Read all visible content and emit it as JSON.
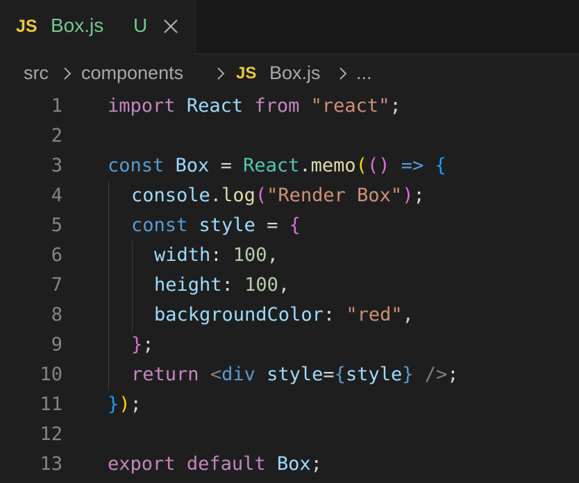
{
  "tab": {
    "icon_label": "JS",
    "file_name": "Box.js",
    "git_status": "U",
    "close_icon": "close-icon"
  },
  "breadcrumb": {
    "items": [
      "src",
      "components",
      "Box.js",
      "..."
    ],
    "file_icon_label": "JS",
    "separator_icon": "chevron-right-icon"
  },
  "editor": {
    "line_numbers": [
      "1",
      "2",
      "3",
      "4",
      "5",
      "6",
      "7",
      "8",
      "9",
      "10",
      "11",
      "12",
      "13"
    ],
    "tokens": {
      "l1": [
        "import",
        " ",
        "React",
        " ",
        "from",
        " ",
        "\"react\"",
        ";"
      ],
      "l3": [
        "const",
        " ",
        "Box",
        " = ",
        "React",
        ".",
        "memo",
        "(",
        "()",
        " => ",
        "{"
      ],
      "l4": [
        "console",
        ".",
        "log",
        "(",
        "\"Render Box\"",
        ")",
        ";"
      ],
      "l5": [
        "const",
        " ",
        "style",
        " = ",
        "{"
      ],
      "l6": [
        "width",
        ": ",
        "100",
        ","
      ],
      "l7": [
        "height",
        ": ",
        "100",
        ","
      ],
      "l8": [
        "backgroundColor",
        ": ",
        "\"red\"",
        ","
      ],
      "l9": [
        "}",
        ";"
      ],
      "l10": [
        "return",
        " ",
        "<",
        "div",
        " ",
        "style",
        "=",
        "{",
        "style",
        "}",
        " />",
        ";"
      ],
      "l11": [
        "}",
        ")",
        ";"
      ],
      "l13": [
        "export",
        " ",
        "default",
        " ",
        "Box",
        ";"
      ]
    }
  },
  "colors": {
    "background": "#1e1e1e",
    "tabbar": "#181818",
    "js_icon": "#e9c83c",
    "untracked": "#73c991",
    "keyword_control": "#c586c0",
    "keyword": "#569cd6",
    "variable": "#9cdcfe",
    "class": "#4ec9b0",
    "function": "#dcdcaa",
    "string": "#ce9178",
    "number": "#b5cea8"
  }
}
